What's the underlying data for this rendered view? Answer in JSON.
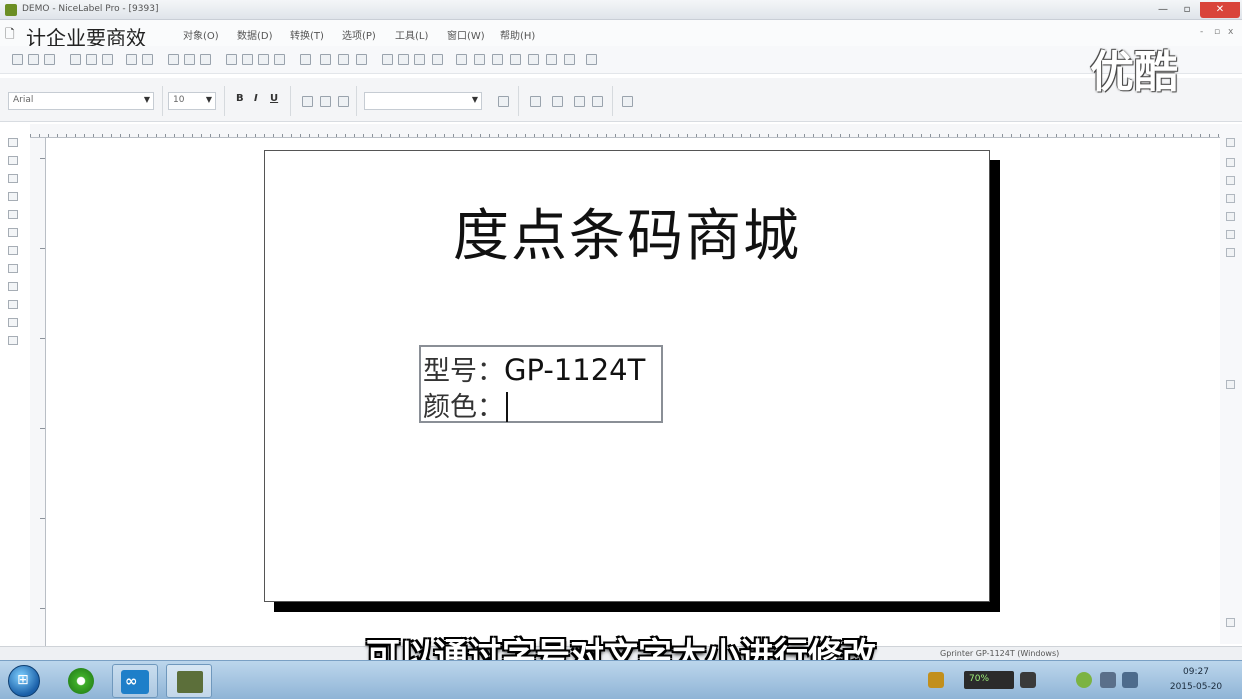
{
  "window": {
    "title": "DEMO - NiceLabel Pro - [9393]",
    "buttons": {
      "minimize": "—",
      "maximize": "▫",
      "close": "✕"
    }
  },
  "menubar": {
    "doc_caption": "计企业要商效",
    "items": [
      "对象(O)",
      "数据(D)",
      "转换(T)",
      "选项(P)",
      "工具(L)",
      "窗口(W)",
      "帮助(H)"
    ],
    "mdi_controls": {
      "minimize": "-",
      "restore": "▫",
      "close": "x"
    }
  },
  "format_toolbar": {
    "font_combo": "Arial",
    "size_combo": "10",
    "bold": "B",
    "italic": "I",
    "underline": "U",
    "style_combo": ""
  },
  "label": {
    "heading": "度点条码商城",
    "textbox": {
      "line1_label": "型号：",
      "line1_value": "GP-1124T",
      "line2_label": "颜色："
    }
  },
  "statusbar": {
    "printer": "Gprinter  GP-1124T (Windows)"
  },
  "subtitle": "可以通过字号对文字大小进行修改",
  "watermark": "优酷",
  "taskbar": {
    "start_label": "⊞",
    "nice_label": "∞",
    "battery_text": "70%",
    "clock_time": "09:27",
    "clock_date": "2015-05-20"
  },
  "colors": {
    "close_button": "#d9443a",
    "taskbar": "#8fb4d6",
    "label_shadow": "#000000"
  }
}
